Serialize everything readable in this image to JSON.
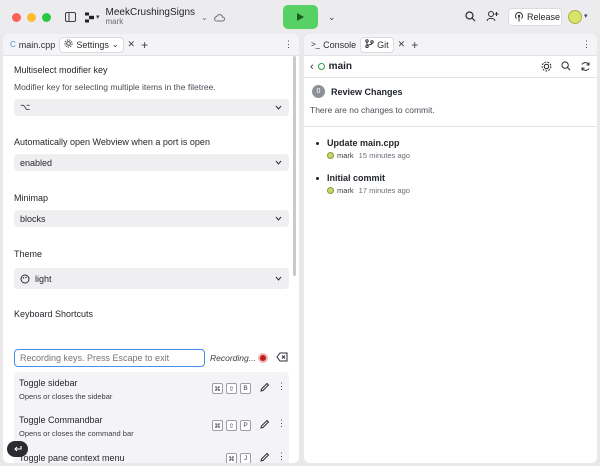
{
  "titlebar": {
    "repl_name": "MeekCrushingSigns",
    "owner": "mark",
    "release_label": "Release"
  },
  "left_pane": {
    "tabs": [
      {
        "label": "main.cpp"
      },
      {
        "label": "Settings"
      }
    ],
    "settings": [
      {
        "label": "Multiselect modifier key",
        "description": "Modifier key for selecting multiple items in the filetree.",
        "value": "⌥"
      },
      {
        "label": "Automatically open Webview when a port is open",
        "value": "enabled"
      },
      {
        "label": "Minimap",
        "value": "blocks"
      },
      {
        "label": "Theme",
        "value": "light"
      }
    ],
    "keyboard_shortcuts": {
      "label": "Keyboard Shortcuts",
      "search_placeholder": "Recording keys. Press Escape to exit",
      "recording_status": "Recording...",
      "items": [
        {
          "title": "Toggle sidebar",
          "description": "Opens or closes the sidebar",
          "keys": [
            "⌘",
            "⇧",
            "B"
          ]
        },
        {
          "title": "Toggle Commandbar",
          "description": "Opens or closes the command bar",
          "keys": [
            "⌘",
            "⇧",
            "P"
          ]
        },
        {
          "title": "Toggle pane context menu",
          "description": "",
          "keys": [
            "⌘",
            "J"
          ]
        }
      ]
    }
  },
  "right_pane": {
    "tabs": [
      {
        "label": "Console"
      },
      {
        "label": "Git"
      }
    ],
    "git": {
      "branch": "main",
      "review_count": "0",
      "review_label": "Review Changes",
      "no_changes_text": "There are no changes to commit.",
      "commits": [
        {
          "title": "Update main.cpp",
          "author": "mark",
          "time": "15 minutes ago"
        },
        {
          "title": "Initial commit",
          "author": "mark",
          "time": "17 minutes ago"
        }
      ]
    }
  },
  "colors": {
    "run_button": "#58d164",
    "focus_border": "#4a8fe6",
    "record_dot": "#c21d1d",
    "branch_dot": "#2ea043"
  }
}
